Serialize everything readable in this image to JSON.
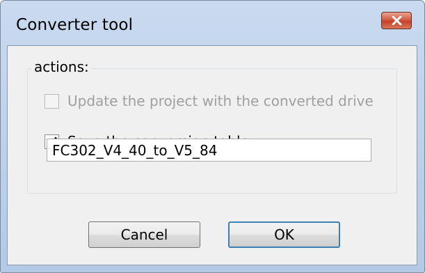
{
  "window": {
    "title": "Converter tool"
  },
  "actions_group": {
    "legend": "actions:",
    "update_project": {
      "label": "Update the project with the converted drive",
      "checked": false,
      "enabled": false
    },
    "save_table": {
      "label": "Save the conversion table",
      "checked": true,
      "enabled": true
    },
    "table_name": {
      "value": "FC302_V4_40_to_V5_84",
      "placeholder": ""
    }
  },
  "buttons": {
    "cancel_label": "Cancel",
    "ok_label": "OK"
  },
  "icons": {
    "close": "close-icon",
    "checkmark": "checkmark-icon"
  },
  "colors": {
    "titlebar": "#c1d5ee",
    "close_button": "#c94a33",
    "dialog_bg": "#f0f0f0",
    "disabled_text": "#a0a0a0",
    "default_button_border": "#3c7fb1"
  }
}
